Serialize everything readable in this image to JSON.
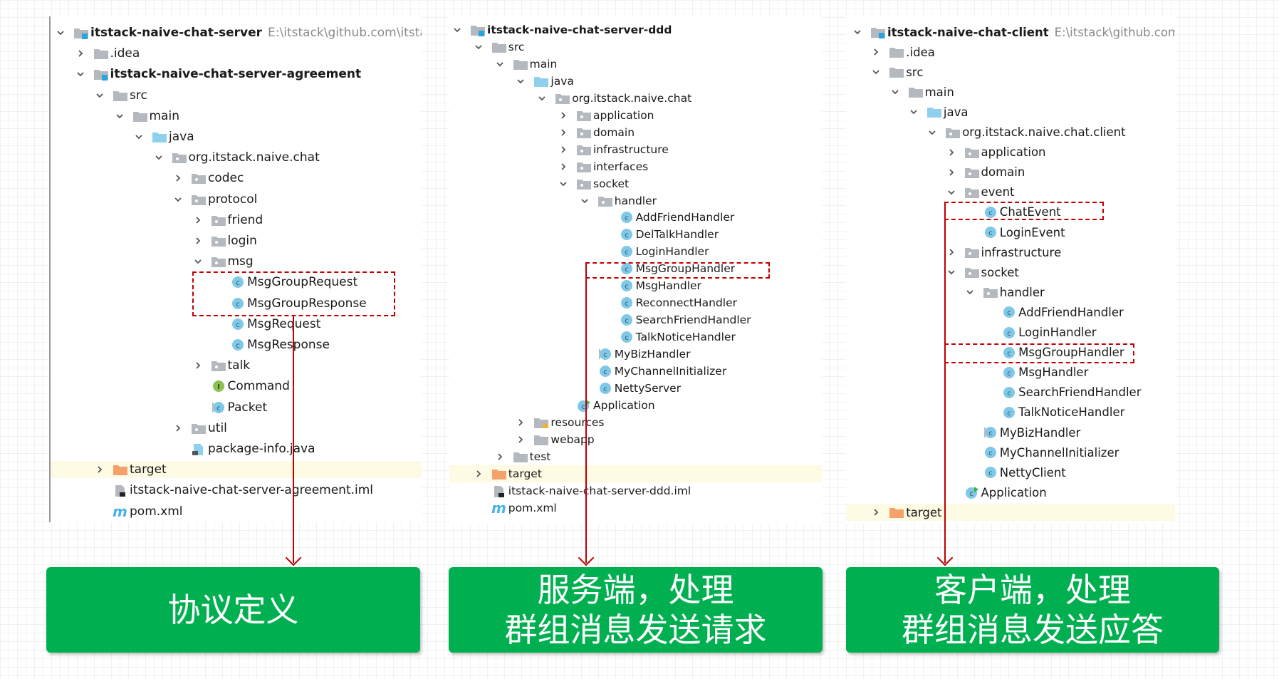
{
  "colors": {
    "accent_green": "#00b050",
    "highlight_red": "#c00000",
    "selected_row": "#fdfbe3",
    "class_icon": "#7ec8e8",
    "folder": "#b4b9bf",
    "java_folder": "#8fd0ee",
    "target_folder": "#f6a06a"
  },
  "panels": [
    {
      "rows": [
        {
          "label": "itstack-naive-chat-server",
          "path": "E:\\itstack\\github.com\\itstack-na",
          "level": 0,
          "kind": "module",
          "state": "open",
          "bold": true
        },
        {
          "label": ".idea",
          "level": 1,
          "kind": "folder",
          "state": "closed"
        },
        {
          "label": "itstack-naive-chat-server-agreement",
          "level": 1,
          "kind": "module",
          "state": "open",
          "bold": true
        },
        {
          "label": "src",
          "level": 2,
          "kind": "folder",
          "state": "open"
        },
        {
          "label": "main",
          "level": 3,
          "kind": "folder",
          "state": "open"
        },
        {
          "label": "java",
          "level": 4,
          "kind": "java",
          "state": "open"
        },
        {
          "label": "org.itstack.naive.chat",
          "level": 5,
          "kind": "package",
          "state": "open"
        },
        {
          "label": "codec",
          "level": 6,
          "kind": "package",
          "state": "closed"
        },
        {
          "label": "protocol",
          "level": 6,
          "kind": "package",
          "state": "open"
        },
        {
          "label": "friend",
          "level": 7,
          "kind": "package",
          "state": "closed"
        },
        {
          "label": "login",
          "level": 7,
          "kind": "package",
          "state": "closed"
        },
        {
          "label": "msg",
          "level": 7,
          "kind": "package",
          "state": "open"
        },
        {
          "label": "MsgGroupRequest",
          "level": 8,
          "kind": "class"
        },
        {
          "label": "MsgGroupResponse",
          "level": 8,
          "kind": "class"
        },
        {
          "label": "MsgRequest",
          "level": 8,
          "kind": "class"
        },
        {
          "label": "MsgResponse",
          "level": 8,
          "kind": "class"
        },
        {
          "label": "talk",
          "level": 7,
          "kind": "package",
          "state": "closed"
        },
        {
          "label": "Command",
          "level": 7,
          "kind": "interface"
        },
        {
          "label": "Packet",
          "level": 7,
          "kind": "abstract"
        },
        {
          "label": "util",
          "level": 6,
          "kind": "package",
          "state": "closed"
        },
        {
          "label": "package-info.java",
          "level": 6,
          "kind": "javafile"
        },
        {
          "label": "target",
          "level": 2,
          "kind": "target",
          "state": "closed",
          "selected": true
        },
        {
          "label": "itstack-naive-chat-server-agreement.iml",
          "level": 2,
          "kind": "iml"
        },
        {
          "label": "pom.xml",
          "level": 2,
          "kind": "pom"
        }
      ]
    },
    {
      "rows": [
        {
          "label": "itstack-naive-chat-server-ddd",
          "level": 0,
          "kind": "module",
          "state": "open",
          "bold": true
        },
        {
          "label": "src",
          "level": 1,
          "kind": "folder",
          "state": "open"
        },
        {
          "label": "main",
          "level": 2,
          "kind": "folder",
          "state": "open"
        },
        {
          "label": "java",
          "level": 3,
          "kind": "java",
          "state": "open"
        },
        {
          "label": "org.itstack.naive.chat",
          "level": 4,
          "kind": "package",
          "state": "open"
        },
        {
          "label": "application",
          "level": 5,
          "kind": "package",
          "state": "closed"
        },
        {
          "label": "domain",
          "level": 5,
          "kind": "package",
          "state": "closed"
        },
        {
          "label": "infrastructure",
          "level": 5,
          "kind": "package",
          "state": "closed"
        },
        {
          "label": "interfaces",
          "level": 5,
          "kind": "package",
          "state": "closed"
        },
        {
          "label": "socket",
          "level": 5,
          "kind": "package",
          "state": "open"
        },
        {
          "label": "handler",
          "level": 6,
          "kind": "package",
          "state": "open"
        },
        {
          "label": "AddFriendHandler",
          "level": 7,
          "kind": "class"
        },
        {
          "label": "DelTalkHandler",
          "level": 7,
          "kind": "class"
        },
        {
          "label": "LoginHandler",
          "level": 7,
          "kind": "class"
        },
        {
          "label": "MsgGroupHandler",
          "level": 7,
          "kind": "class"
        },
        {
          "label": "MsgHandler",
          "level": 7,
          "kind": "class"
        },
        {
          "label": "ReconnectHandler",
          "level": 7,
          "kind": "class"
        },
        {
          "label": "SearchFriendHandler",
          "level": 7,
          "kind": "class"
        },
        {
          "label": "TalkNoticeHandler",
          "level": 7,
          "kind": "class"
        },
        {
          "label": "MyBizHandler",
          "level": 6,
          "kind": "abstract"
        },
        {
          "label": "MyChannelInitializer",
          "level": 6,
          "kind": "class"
        },
        {
          "label": "NettyServer",
          "level": 6,
          "kind": "class"
        },
        {
          "label": "Application",
          "level": 5,
          "kind": "app"
        },
        {
          "label": "resources",
          "level": 3,
          "kind": "resources",
          "state": "closed"
        },
        {
          "label": "webapp",
          "level": 3,
          "kind": "folder",
          "state": "closed"
        },
        {
          "label": "test",
          "level": 2,
          "kind": "folder",
          "state": "closed"
        },
        {
          "label": "target",
          "level": 1,
          "kind": "target",
          "state": "closed",
          "selected": true
        },
        {
          "label": "itstack-naive-chat-server-ddd.iml",
          "level": 1,
          "kind": "iml"
        },
        {
          "label": "pom.xml",
          "level": 1,
          "kind": "pom"
        }
      ]
    },
    {
      "rows": [
        {
          "label": "itstack-naive-chat-client",
          "path": "E:\\itstack\\github.com\\itstac",
          "level": 0,
          "kind": "module",
          "state": "open",
          "bold": true
        },
        {
          "label": ".idea",
          "level": 1,
          "kind": "folder",
          "state": "closed"
        },
        {
          "label": "src",
          "level": 1,
          "kind": "folder",
          "state": "open"
        },
        {
          "label": "main",
          "level": 2,
          "kind": "folder",
          "state": "open"
        },
        {
          "label": "java",
          "level": 3,
          "kind": "java",
          "state": "open"
        },
        {
          "label": "org.itstack.naive.chat.client",
          "level": 4,
          "kind": "package",
          "state": "open"
        },
        {
          "label": "application",
          "level": 5,
          "kind": "package",
          "state": "closed"
        },
        {
          "label": "domain",
          "level": 5,
          "kind": "package",
          "state": "closed"
        },
        {
          "label": "event",
          "level": 5,
          "kind": "package",
          "state": "open"
        },
        {
          "label": "ChatEvent",
          "level": 6,
          "kind": "class"
        },
        {
          "label": "LoginEvent",
          "level": 6,
          "kind": "class"
        },
        {
          "label": "infrastructure",
          "level": 5,
          "kind": "package",
          "state": "closed"
        },
        {
          "label": "socket",
          "level": 5,
          "kind": "package",
          "state": "open"
        },
        {
          "label": "handler",
          "level": 6,
          "kind": "package",
          "state": "open"
        },
        {
          "label": "AddFriendHandler",
          "level": 7,
          "kind": "class"
        },
        {
          "label": "LoginHandler",
          "level": 7,
          "kind": "class"
        },
        {
          "label": "MsgGroupHandler",
          "level": 7,
          "kind": "class"
        },
        {
          "label": "MsgHandler",
          "level": 7,
          "kind": "class"
        },
        {
          "label": "SearchFriendHandler",
          "level": 7,
          "kind": "class"
        },
        {
          "label": "TalkNoticeHandler",
          "level": 7,
          "kind": "class"
        },
        {
          "label": "MyBizHandler",
          "level": 6,
          "kind": "abstract"
        },
        {
          "label": "MyChannelInitializer",
          "level": 6,
          "kind": "class"
        },
        {
          "label": "NettyClient",
          "level": 6,
          "kind": "class"
        },
        {
          "label": "Application",
          "level": 5,
          "kind": "app"
        },
        {
          "label": "target",
          "level": 1,
          "kind": "target",
          "state": "closed",
          "selected": true
        }
      ]
    }
  ],
  "captions": [
    {
      "lines": [
        "协议定义"
      ]
    },
    {
      "lines": [
        "服务端，处理",
        "群组消息发送请求"
      ]
    },
    {
      "lines": [
        "客户端，处理",
        "群组消息发送应答"
      ]
    }
  ]
}
